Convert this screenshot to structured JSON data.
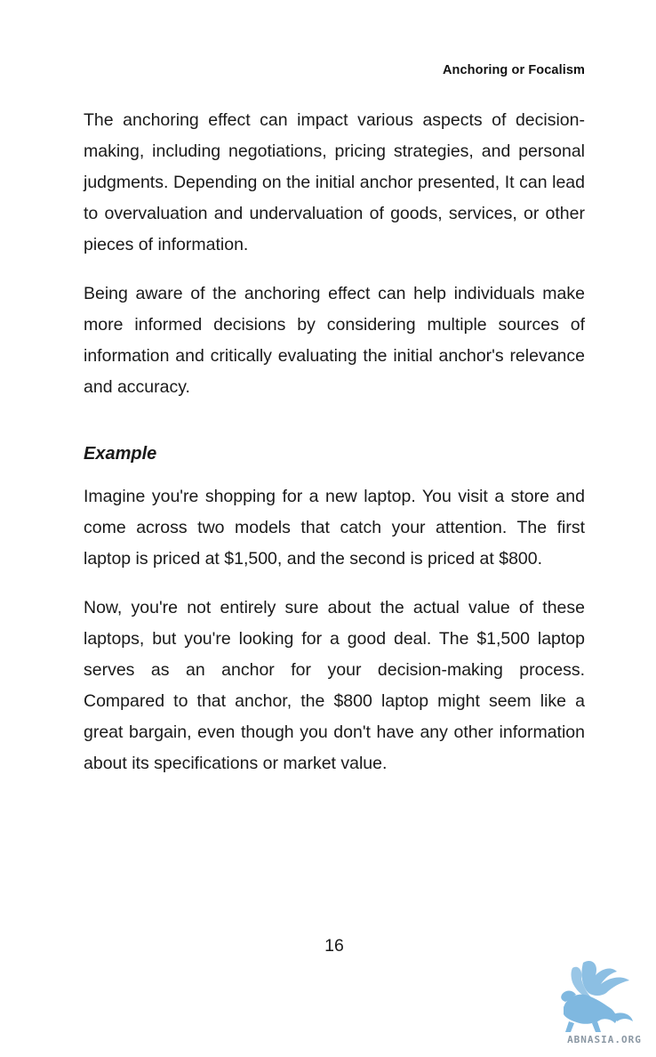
{
  "header": {
    "running_title": "Anchoring or Focalism"
  },
  "body": {
    "paragraph_1": "The anchoring effect can impact various aspects of decision-making, including negotiations, pricing strategies, and personal judgments. Depending on the initial anchor presented, It can lead to overvaluation and undervaluation of goods, services, or other pieces of information.",
    "paragraph_2": "Being aware of the anchoring effect can help individuals make more informed decisions by considering multiple sources of information and critically evaluating the initial anchor's relevance and accuracy.",
    "example_heading": "Example",
    "paragraph_3": "Imagine you're shopping for a new laptop. You visit a store and come across two models that catch your attention. The first laptop is priced at $1,500, and the second is priced at $800.",
    "paragraph_4": "Now, you're not entirely sure about the actual value of these laptops, but you're looking for a good deal. The $1,500 laptop serves as an anchor for your decision-making process. Compared to that anchor, the $800 laptop might seem like a great bargain, even though you don't have any other information about its specifications or market value."
  },
  "footer": {
    "page_number": "16"
  },
  "watermark": {
    "text": "ABNASIA.ORG",
    "icon": "griffin-logo-icon",
    "color": "#7fb8e0"
  }
}
